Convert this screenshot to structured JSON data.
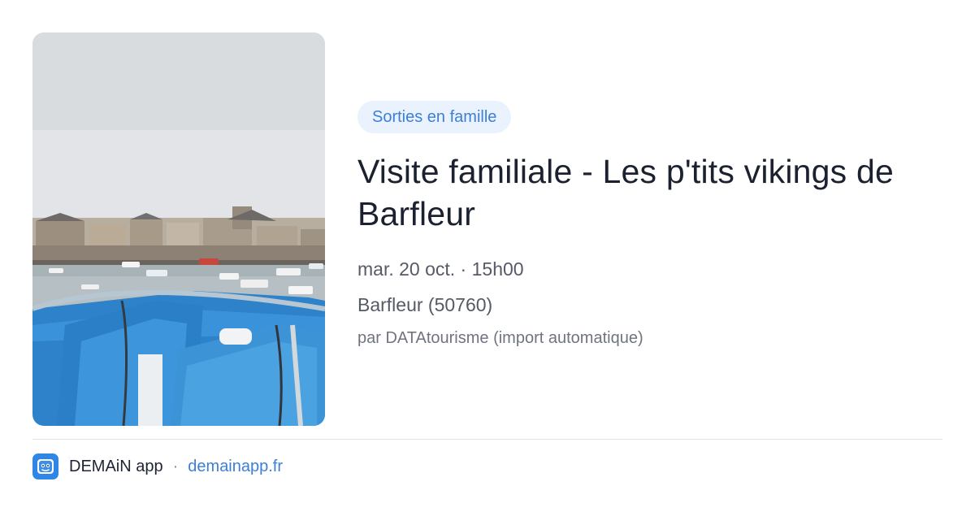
{
  "event": {
    "image_alt": "",
    "category": "Sorties en famille",
    "title": "Visite familiale - Les p'tits vikings de Barfleur",
    "date_time": "mar. 20 oct. · 15h00",
    "location": "Barfleur (50760)",
    "source": "par DATAtourisme (import automatique)"
  },
  "footer": {
    "app_icon": "demain-app-logo-icon",
    "app_name": "DEMAiN app",
    "separator": "·",
    "link": "demainapp.fr"
  },
  "colors": {
    "accent": "#3d7fd6",
    "tag_bg": "#eaf2fd",
    "app_icon_bg": "#2f86e6"
  }
}
